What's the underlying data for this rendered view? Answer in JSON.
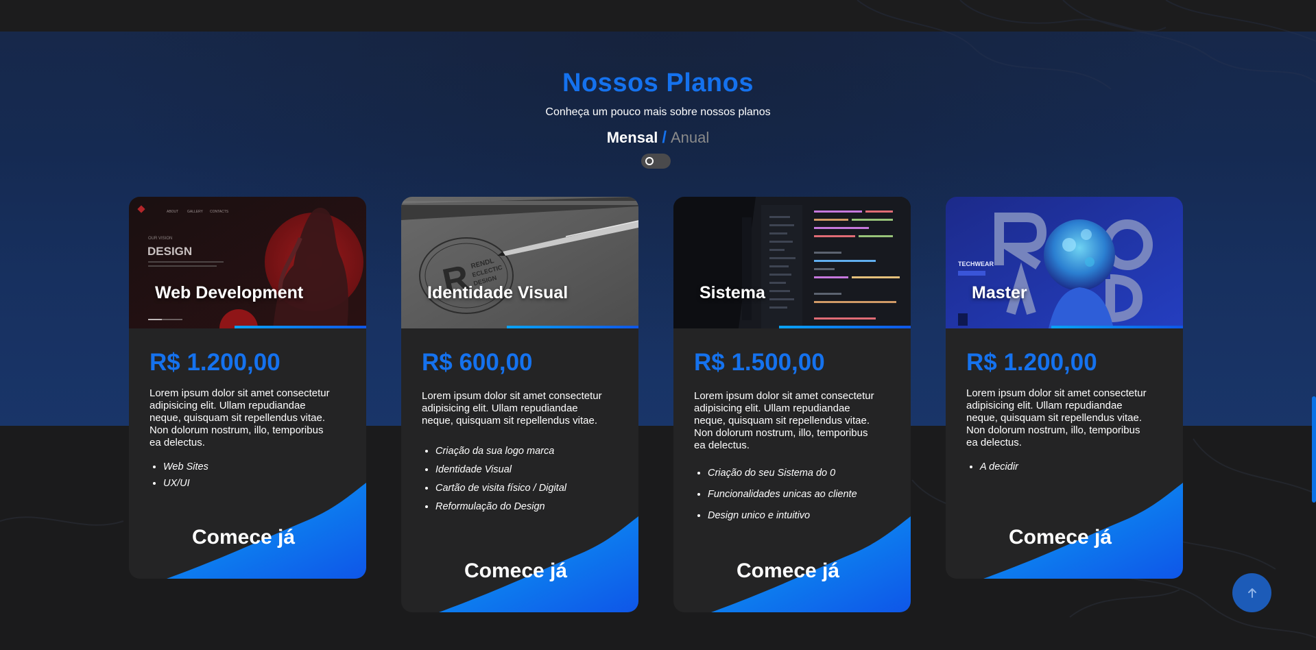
{
  "section": {
    "title": "Nossos Planos",
    "subtitle": "Conheça um pouco mais sobre nossos planos",
    "billing": {
      "monthly": "Mensal",
      "separator": "/",
      "annual": "Anual",
      "annual_active": false
    }
  },
  "plans": [
    {
      "title": "Web Development",
      "price": "R$ 1.200,00",
      "description": "Lorem ipsum dolor sit amet consectetur adipisicing elit. Ullam repudiandae neque, quisquam sit repellendus vitae. Non dolorum nostrum, illo, temporibus ea delectus.",
      "features": [
        "Web Sites",
        "UX/UI"
      ],
      "cta": "Comece já",
      "image_label": "DESIGN",
      "image_kicker": "OUR VISION",
      "image_nav": [
        "ABOUT",
        "GALLERY",
        "CONTACTS"
      ]
    },
    {
      "title": "Identidade Visual",
      "price": "R$ 600,00",
      "description": "Lorem ipsum dolor sit amet consectetur adipisicing elit. Ullam repudiandae neque, quisquam sit repellendus vitae.",
      "features": [
        "Criação da sua logo marca",
        "Identidade Visual",
        "Cartão de visita físico / Digital",
        "Reformulação do Design"
      ],
      "cta": "Comece já",
      "image_label": "RENDL ECLECTIC DESIGN"
    },
    {
      "title": "Sistema",
      "price": "R$ 1.500,00",
      "description": "Lorem ipsum dolor sit amet consectetur adipisicing elit. Ullam repudiandae neque, quisquam sit repellendus vitae. Non dolorum nostrum, illo, temporibus ea delectus.",
      "features": [
        "Criação do seu Sistema do 0",
        "Funcionalidades unicas ao cliente",
        "Design unico e intuitivo"
      ],
      "cta": "Comece já"
    },
    {
      "title": "Master",
      "price": "R$ 1.200,00",
      "description": "Lorem ipsum dolor sit amet consectetur adipisicing elit. Ullam repudiandae neque, quisquam sit repellendus vitae. Non dolorum nostrum, illo, temporibus ea delectus.",
      "features": [
        "A decidir"
      ],
      "cta": "Comece já",
      "image_label": "TECHWEAR"
    }
  ],
  "icons": {
    "back_to_top": "arrow-up-icon"
  },
  "colors": {
    "accent": "#1572ee",
    "card": "#242425",
    "wave_start": "#0aa3f5",
    "wave_end": "#0f56e8",
    "back_to_top": "#1c5bb8"
  }
}
